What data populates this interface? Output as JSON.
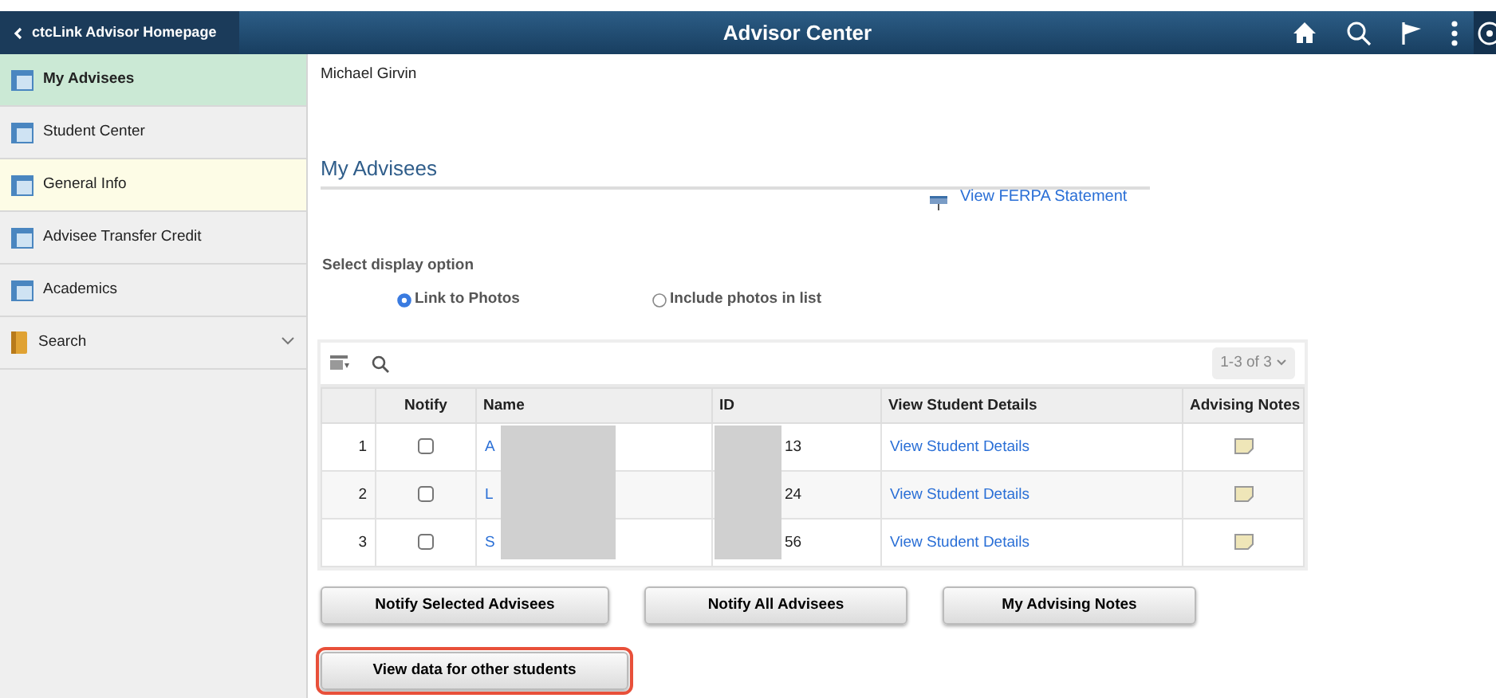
{
  "header": {
    "back_button": "ctcLink Advisor Homepage",
    "title": "Advisor Center"
  },
  "sidebar": {
    "items": [
      {
        "label": "My Advisees",
        "kind": "page",
        "selected": true,
        "hovered": false
      },
      {
        "label": "Student Center",
        "kind": "page",
        "selected": false,
        "hovered": false
      },
      {
        "label": "General Info",
        "kind": "page",
        "selected": false,
        "hovered": true
      },
      {
        "label": "Advisee Transfer Credit",
        "kind": "page",
        "selected": false,
        "hovered": false
      },
      {
        "label": "Academics",
        "kind": "page",
        "selected": false,
        "hovered": false
      },
      {
        "label": "Search",
        "kind": "folder",
        "selected": false,
        "hovered": false,
        "expanded": false
      }
    ]
  },
  "user_name": "Michael Girvin",
  "section_title": "My Advisees",
  "ferpa_link": "View FERPA Statement",
  "display_option": {
    "label": "Select display option",
    "options": [
      {
        "label": "Link to Photos",
        "selected": true
      },
      {
        "label": "Include photos in list",
        "selected": false
      }
    ]
  },
  "table": {
    "pager": "1-3 of 3",
    "columns": [
      "Notify",
      "Name",
      "ID",
      "View Student Details",
      "Advising Notes"
    ],
    "rows": [
      {
        "number": "1",
        "notify": false,
        "name": "A",
        "id": "13",
        "details": "View Student Details"
      },
      {
        "number": "2",
        "notify": false,
        "name": "L",
        "id": "24",
        "details": "View Student Details"
      },
      {
        "number": "3",
        "notify": false,
        "name": "S",
        "id": "56",
        "details": "View Student Details"
      }
    ]
  },
  "buttons": [
    {
      "label": "Notify Selected Advisees",
      "highlighted": false
    },
    {
      "label": "Notify All Advisees",
      "highlighted": false
    },
    {
      "label": "My Advising Notes",
      "highlighted": false
    }
  ],
  "footer_button": {
    "label": "View data for other students",
    "highlighted": true
  }
}
